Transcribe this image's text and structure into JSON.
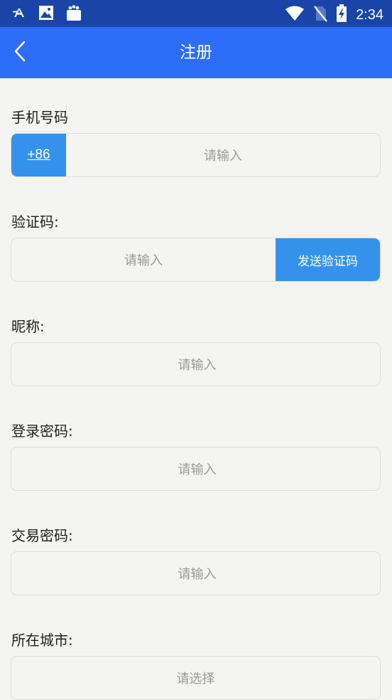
{
  "status_bar": {
    "time": "2:34",
    "icons": [
      "font-a-icon",
      "photo-icon",
      "shopping-bag-icon",
      "wifi-icon",
      "no-sim-icon",
      "battery-charging-icon"
    ]
  },
  "header": {
    "title": "注册",
    "back_icon": "chevron-left-icon"
  },
  "form": {
    "phone": {
      "label": "手机号码",
      "country_code": "+86",
      "placeholder": "请输入"
    },
    "verify_code": {
      "label": "验证码:",
      "placeholder": "请输入",
      "send_button": "发送验证码"
    },
    "nickname": {
      "label": "昵称:",
      "placeholder": "请输入"
    },
    "login_password": {
      "label": "登录密码:",
      "placeholder": "请输入"
    },
    "trade_password": {
      "label": "交易密码:",
      "placeholder": "请输入"
    },
    "city": {
      "label": "所在城市:",
      "placeholder": "请选择"
    }
  },
  "colors": {
    "status_bar": "#1a44a8",
    "app_bar": "#2c6ef7",
    "accent_button": "#3592ec",
    "background": "#f4f4f2"
  }
}
